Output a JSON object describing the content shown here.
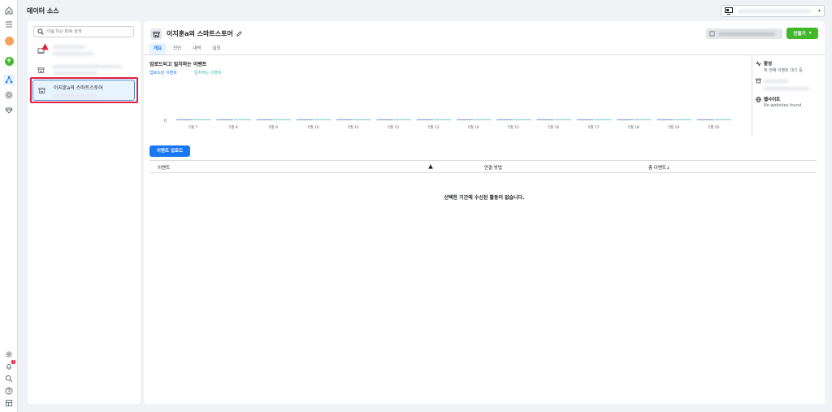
{
  "page_title": "데이터 소스",
  "search": {
    "placeholder": "이름 또는 ID로 검색"
  },
  "selected_source": {
    "name": "이지훈a의 스마트스토어"
  },
  "main": {
    "title": "이지훈a의 스마트스토어",
    "create_button": "만들기",
    "tabs": [
      "개요",
      "진단",
      "내역",
      "설정"
    ],
    "active_tab": "개요",
    "section_title": "업로드되고 일치하는 이벤트",
    "legend_uploaded": "업로드된 이벤트",
    "legend_matched": "일치하는 이벤트",
    "side": {
      "activity_title": "활성",
      "activity_sub": "첫 번째 이벤트 대기 중",
      "website_title": "웹사이트",
      "website_sub": "No websites found"
    },
    "upload_button": "이벤트 업로드",
    "table_headers": {
      "event": "이벤트",
      "connection": "연결 방법",
      "total": "총 이벤트↓"
    },
    "empty_message": "선택한 기간에 수신된 활동이 없습니다."
  },
  "rail": {
    "notification_count": "1"
  },
  "colors": {
    "uploaded": "#8a9fe0",
    "matched": "#7fd6cb",
    "primary": "#1877f2",
    "create": "#42b72a"
  },
  "chart_data": {
    "type": "bar",
    "categories": [
      "5월 7",
      "5월 8",
      "5월 9",
      "5월 10",
      "5월 11",
      "5월 12",
      "5월 13",
      "5월 14",
      "5월 15",
      "5월 16",
      "5월 17",
      "5월 18",
      "5월 19",
      "5월 20"
    ],
    "series": [
      {
        "name": "업로드된 이벤트",
        "values": [
          0,
          0,
          0,
          0,
          0,
          0,
          0,
          0,
          0,
          0,
          0,
          0,
          0,
          0
        ]
      },
      {
        "name": "일치하는 이벤트",
        "values": [
          0,
          0,
          0,
          0,
          0,
          0,
          0,
          0,
          0,
          0,
          0,
          0,
          0,
          0
        ]
      }
    ],
    "yticks": [
      "0"
    ],
    "ylim": [
      0,
      1
    ]
  }
}
